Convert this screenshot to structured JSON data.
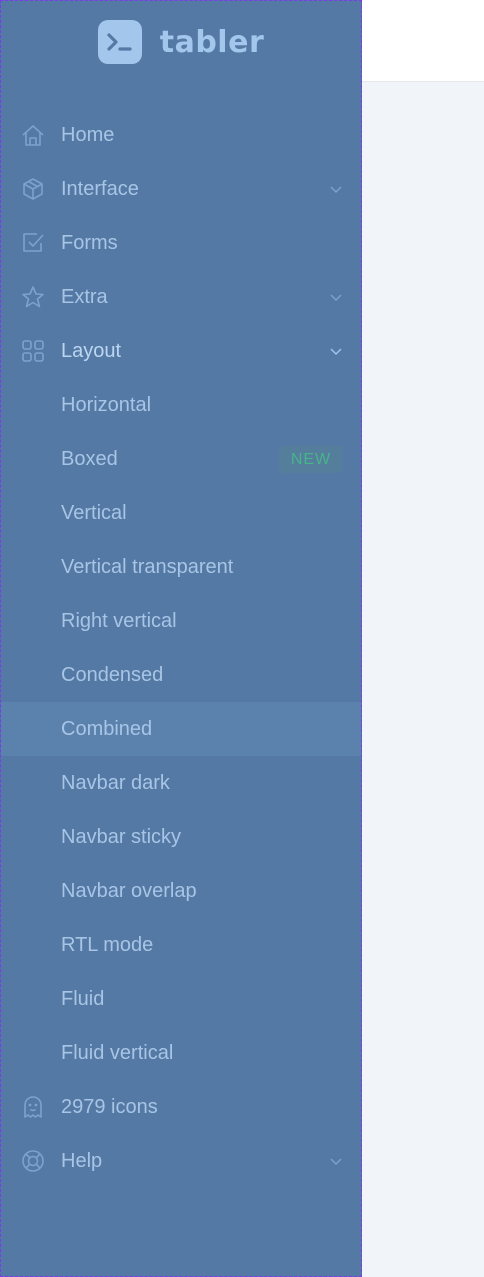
{
  "brand": {
    "name": "tabler",
    "logo_icon": "terminal-icon"
  },
  "nav": {
    "home": "Home",
    "interface": "Interface",
    "forms": "Forms",
    "extra": "Extra",
    "layout": "Layout",
    "layout_items": [
      "Horizontal",
      "Boxed",
      "Vertical",
      "Vertical transparent",
      "Right vertical",
      "Condensed",
      "Combined",
      "Navbar dark",
      "Navbar sticky",
      "Navbar overlap",
      "RTL mode",
      "Fluid",
      "Fluid vertical"
    ],
    "boxed_badge": "NEW",
    "icons": "2979 icons",
    "help": "Help"
  },
  "colors": {
    "sidebar_bg": "#5479a4",
    "text": "#a8c5e6",
    "active_row": "#5a82ad",
    "badge_text": "#46b58a"
  }
}
